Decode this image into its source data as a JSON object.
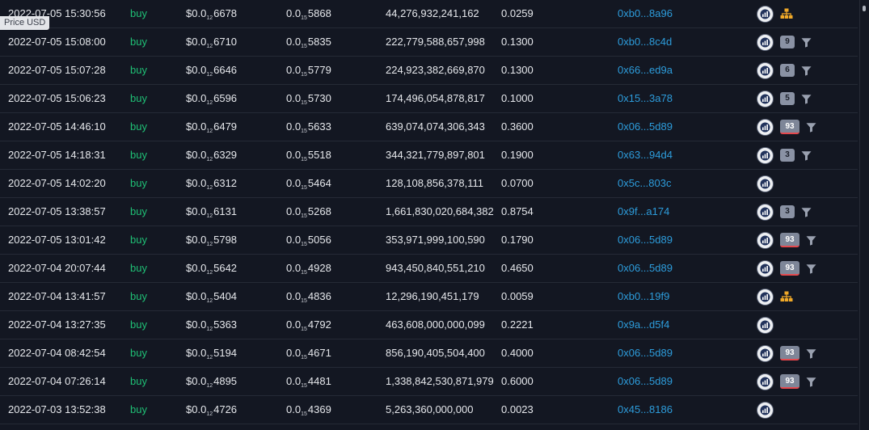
{
  "tooltip": "Price USD",
  "rows": [
    {
      "date": "2022-07-05 15:30:56",
      "type": "buy",
      "price_prefix": "$0.0",
      "price_sub": "12",
      "price_tail": "6678",
      "native_prefix": "0.0",
      "native_sub": "15",
      "native_tail": "5868",
      "amount": "44,276,932,241,162",
      "total": "0.0259",
      "maker": "0xb0...8a96",
      "badge": "",
      "icon": "hierarchy"
    },
    {
      "date": "2022-07-05 15:08:00",
      "type": "buy",
      "price_prefix": "$0.0",
      "price_sub": "12",
      "price_tail": "6710",
      "native_prefix": "0.0",
      "native_sub": "15",
      "native_tail": "5835",
      "amount": "222,779,588,657,998",
      "total": "0.1300",
      "maker": "0xb0...8c4d",
      "badge": "9",
      "icon": "filter"
    },
    {
      "date": "2022-07-05 15:07:28",
      "type": "buy",
      "price_prefix": "$0.0",
      "price_sub": "12",
      "price_tail": "6646",
      "native_prefix": "0.0",
      "native_sub": "15",
      "native_tail": "5779",
      "amount": "224,923,382,669,870",
      "total": "0.1300",
      "maker": "0x66...ed9a",
      "badge": "6",
      "icon": "filter"
    },
    {
      "date": "2022-07-05 15:06:23",
      "type": "buy",
      "price_prefix": "$0.0",
      "price_sub": "12",
      "price_tail": "6596",
      "native_prefix": "0.0",
      "native_sub": "15",
      "native_tail": "5730",
      "amount": "174,496,054,878,817",
      "total": "0.1000",
      "maker": "0x15...3a78",
      "badge": "5",
      "icon": "filter"
    },
    {
      "date": "2022-07-05 14:46:10",
      "type": "buy",
      "price_prefix": "$0.0",
      "price_sub": "12",
      "price_tail": "6479",
      "native_prefix": "0.0",
      "native_sub": "15",
      "native_tail": "5633",
      "amount": "639,074,074,306,343",
      "total": "0.3600",
      "maker": "0x06...5d89",
      "badge": "93",
      "icon": "filter"
    },
    {
      "date": "2022-07-05 14:18:31",
      "type": "buy",
      "price_prefix": "$0.0",
      "price_sub": "12",
      "price_tail": "6329",
      "native_prefix": "0.0",
      "native_sub": "15",
      "native_tail": "5518",
      "amount": "344,321,779,897,801",
      "total": "0.1900",
      "maker": "0x63...94d4",
      "badge": "3",
      "icon": "filter"
    },
    {
      "date": "2022-07-05 14:02:20",
      "type": "buy",
      "price_prefix": "$0.0",
      "price_sub": "12",
      "price_tail": "6312",
      "native_prefix": "0.0",
      "native_sub": "15",
      "native_tail": "5464",
      "amount": "128,108,856,378,111",
      "total": "0.0700",
      "maker": "0x5c...803c",
      "badge": "",
      "icon": ""
    },
    {
      "date": "2022-07-05 13:38:57",
      "type": "buy",
      "price_prefix": "$0.0",
      "price_sub": "12",
      "price_tail": "6131",
      "native_prefix": "0.0",
      "native_sub": "15",
      "native_tail": "5268",
      "amount": "1,661,830,020,684,382",
      "total": "0.8754",
      "maker": "0x9f...a174",
      "badge": "3",
      "icon": "filter"
    },
    {
      "date": "2022-07-05 13:01:42",
      "type": "buy",
      "price_prefix": "$0.0",
      "price_sub": "12",
      "price_tail": "5798",
      "native_prefix": "0.0",
      "native_sub": "15",
      "native_tail": "5056",
      "amount": "353,971,999,100,590",
      "total": "0.1790",
      "maker": "0x06...5d89",
      "badge": "93",
      "icon": "filter"
    },
    {
      "date": "2022-07-04 20:07:44",
      "type": "buy",
      "price_prefix": "$0.0",
      "price_sub": "12",
      "price_tail": "5642",
      "native_prefix": "0.0",
      "native_sub": "15",
      "native_tail": "4928",
      "amount": "943,450,840,551,210",
      "total": "0.4650",
      "maker": "0x06...5d89",
      "badge": "93",
      "icon": "filter"
    },
    {
      "date": "2022-07-04 13:41:57",
      "type": "buy",
      "price_prefix": "$0.0",
      "price_sub": "12",
      "price_tail": "5404",
      "native_prefix": "0.0",
      "native_sub": "15",
      "native_tail": "4836",
      "amount": "12,296,190,451,179",
      "total": "0.0059",
      "maker": "0xb0...19f9",
      "badge": "",
      "icon": "hierarchy"
    },
    {
      "date": "2022-07-04 13:27:35",
      "type": "buy",
      "price_prefix": "$0.0",
      "price_sub": "12",
      "price_tail": "5363",
      "native_prefix": "0.0",
      "native_sub": "15",
      "native_tail": "4792",
      "amount": "463,608,000,000,099",
      "total": "0.2221",
      "maker": "0x9a...d5f4",
      "badge": "",
      "icon": ""
    },
    {
      "date": "2022-07-04 08:42:54",
      "type": "buy",
      "price_prefix": "$0.0",
      "price_sub": "12",
      "price_tail": "5194",
      "native_prefix": "0.0",
      "native_sub": "15",
      "native_tail": "4671",
      "amount": "856,190,405,504,400",
      "total": "0.4000",
      "maker": "0x06...5d89",
      "badge": "93",
      "icon": "filter"
    },
    {
      "date": "2022-07-04 07:26:14",
      "type": "buy",
      "price_prefix": "$0.0",
      "price_sub": "12",
      "price_tail": "4895",
      "native_prefix": "0.0",
      "native_sub": "15",
      "native_tail": "4481",
      "amount": "1,338,842,530,871,979",
      "total": "0.6000",
      "maker": "0x06...5d89",
      "badge": "93",
      "icon": "filter"
    },
    {
      "date": "2022-07-03 13:52:38",
      "type": "buy",
      "price_prefix": "$0.0",
      "price_sub": "12",
      "price_tail": "4726",
      "native_prefix": "0.0",
      "native_sub": "15",
      "native_tail": "4369",
      "amount": "5,263,360,000,000",
      "total": "0.0023",
      "maker": "0x45...8186",
      "badge": "",
      "icon": ""
    }
  ],
  "colors": {
    "buy": "#1fbf75",
    "maker_link": "#2d9cdb",
    "hierarchy": "#f0a928",
    "background": "#131722"
  },
  "icons": {
    "explorer": "etherscan-icon",
    "filter": "filter-icon",
    "hierarchy": "hierarchy-icon"
  }
}
